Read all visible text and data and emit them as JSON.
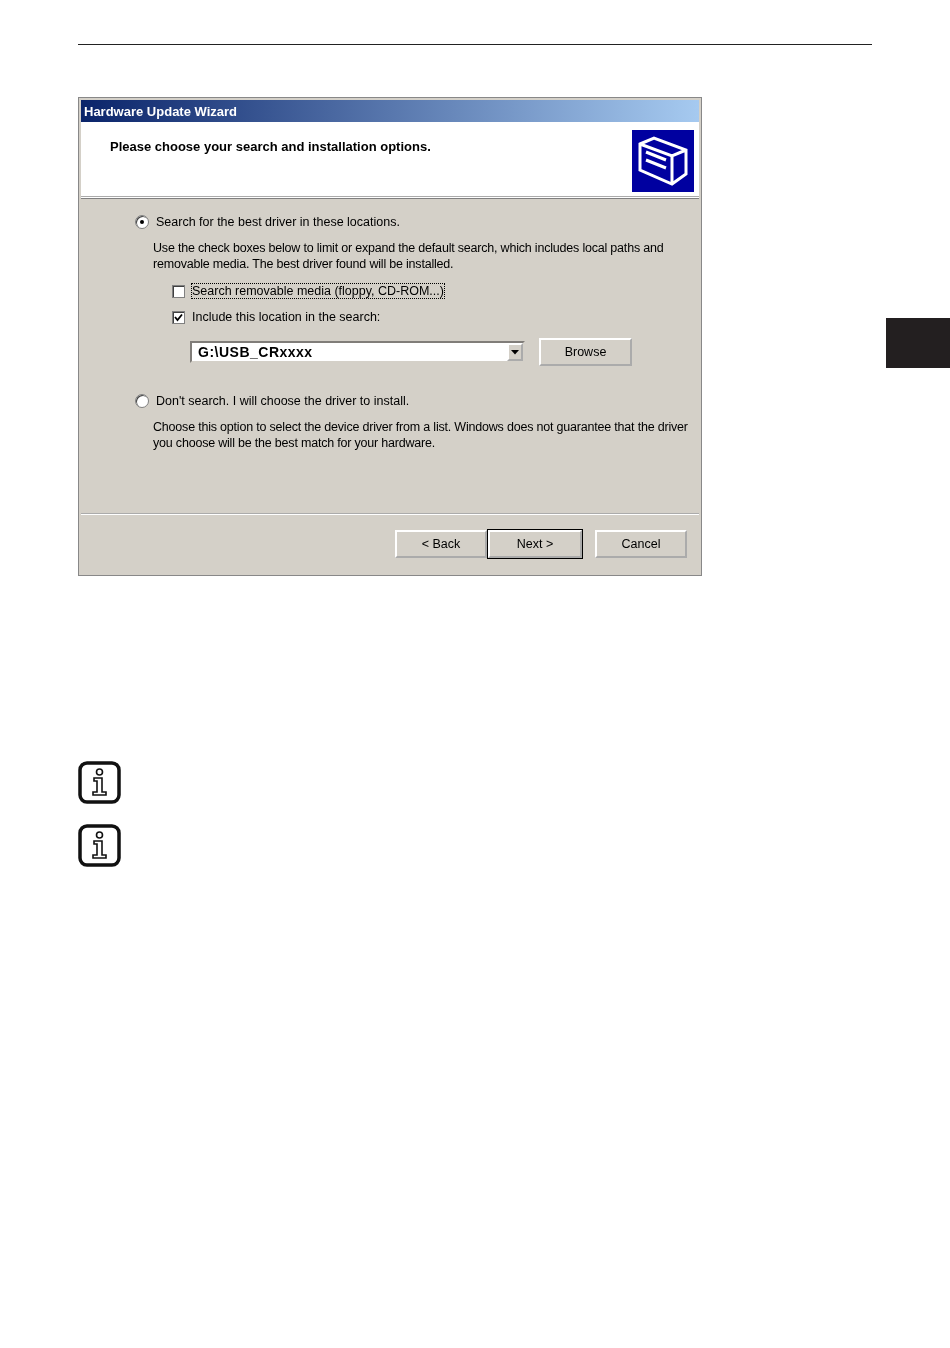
{
  "window": {
    "title": "Hardware Update Wizard"
  },
  "header": {
    "heading": "Please choose your search and installation options."
  },
  "options": [
    {
      "label": "Search for the best driver in these locations.",
      "selected": true,
      "description": "Use the check boxes below to limit or expand the default search, which includes local paths and removable media. The best driver found will be installed.",
      "checkboxes": [
        {
          "label": "Search removable media (floppy, CD-ROM...)",
          "checked": false,
          "focused": true
        },
        {
          "label": "Include this location in the search:",
          "checked": true,
          "focused": false
        }
      ],
      "location": {
        "value": "G:\\USB_CRxxxx"
      },
      "browse_button": "Browse"
    },
    {
      "label": "Don't search. I will choose the driver to install.",
      "selected": false,
      "description": "Choose this option to select the device driver from a list.  Windows does not guarantee that the driver you choose will be the best match for your hardware."
    }
  ],
  "buttons": [
    {
      "label": "< Back",
      "default": false
    },
    {
      "label": "Next >",
      "default": true
    },
    {
      "label": "Cancel",
      "default": false
    }
  ],
  "notes": [
    {
      "kind": "info"
    },
    {
      "kind": "info"
    }
  ]
}
